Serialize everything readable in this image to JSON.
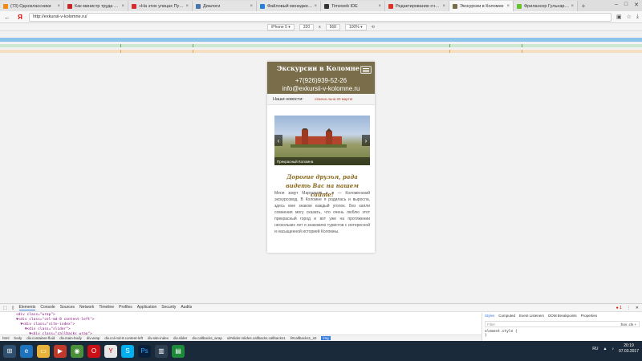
{
  "browser": {
    "tabs": [
      {
        "title": "(73) Одноклассники",
        "color": "#f08a1a"
      },
      {
        "title": "Как министр труда Макси…",
        "color": "#c1272d"
      },
      {
        "title": "«На этих улицах Путин на…",
        "color": "#d32f2f"
      },
      {
        "title": "Диалоги",
        "color": "#4a76a8"
      },
      {
        "title": "Файловый менеджер – ПА…",
        "color": "#2a7fd4"
      },
      {
        "title": "Timeweb IDE",
        "color": "#333333"
      },
      {
        "title": "Редактирование счётчик…",
        "color": "#d9342b"
      },
      {
        "title": "Экскурсии в Коломне",
        "color": "#7a6e4a"
      },
      {
        "title": "Фрилансер Гульнара Саи…",
        "color": "#6abf2d"
      }
    ],
    "url": "http://exkursii-v-kolomne.ru/"
  },
  "device_toolbar": {
    "device": "iPhone 5 ▾",
    "width": "320",
    "times": "x",
    "height": "568",
    "zoom": "100% ▾"
  },
  "site": {
    "title": "Экскурсии в Коломне",
    "phone": "+7(926)939-52-26",
    "email": "info@exkursii-v-kolomne.ru",
    "news_label": "Наши новости:",
    "news_text": "отмена льна 20 марта!",
    "slide_caption": "Прекрасный Коломна",
    "greeting": "Дорогие друзья, рада видеть Вас на нашем сайте!",
    "paragraph": "Меня зовут Маргарита и я — Коломенский экскурсовод. В Коломне я родилась и выросла, здесь мне знаком каждый уголок. Без капли сомнения могу сказать, что очень люблю этот прекрасный город и вот уже на протяжении нескольких лет я знакомлю туристов с интересной и насыщенной историей Коломны."
  },
  "devtools": {
    "tabs": [
      "Elements",
      "Console",
      "Sources",
      "Network",
      "Timeline",
      "Profiles",
      "Application",
      "Security",
      "Audits"
    ],
    "errors": "1",
    "dom_lines": [
      "<div class=\"wrap\">",
      "▼<div class=\"col-md-8 content-left\">",
      "  ▼<div class=\"site-index\">",
      "    ▼<div class=\"slider\">",
      "      ▼<div class=\"callbacks_wrap\">"
    ],
    "breadcrumbs": [
      "html",
      "body",
      "div.container-fluid",
      "div.main-body",
      "div.wrap",
      "div.col-md-8.content-left",
      "div.site-index",
      "div.slider",
      "div.callbacks_wrap",
      "ul#slider.rslides.callbacks.callbacks1",
      "li#callbacks1_s0"
    ],
    "selected_crumb": "img",
    "styles_tabs": [
      "Styles",
      "Computed",
      "Event Listeners",
      "DOM Breakpoints",
      "Properties"
    ],
    "filter_placeholder": "Filter",
    "filter_toggles": ":hov .cls +",
    "style_rule": "element.style {",
    "style_rule_end": "}"
  },
  "taskbar": {
    "lang": "RU",
    "time": "20:19",
    "date": "07.03.2017"
  }
}
